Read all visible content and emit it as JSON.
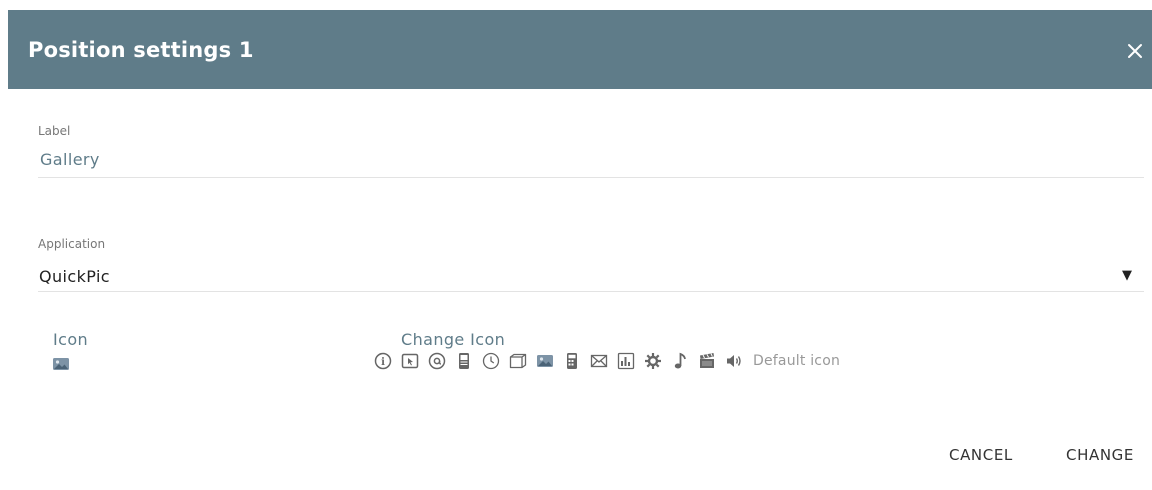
{
  "dialog": {
    "title": "Position settings 1",
    "close_icon": "close-icon"
  },
  "label_field": {
    "label": "Label",
    "value": "Gallery"
  },
  "application_field": {
    "label": "Application",
    "value": "QuickPic",
    "dropdown_icon": "caret-down-icon"
  },
  "icon_section": {
    "title": "Icon",
    "current_icon": "gallery-icon"
  },
  "change_icon_section": {
    "title": "Change Icon",
    "icons": [
      "info-icon",
      "cursor-icon",
      "at-sign-icon",
      "phone-icon",
      "clock-icon",
      "folder-icon",
      "gallery-icon",
      "calculator-icon",
      "mail-icon",
      "chart-icon",
      "gear-icon",
      "music-note-icon",
      "clapperboard-icon",
      "speaker-icon"
    ],
    "default_label": "Default icon"
  },
  "buttons": {
    "cancel": "CANCEL",
    "change": "CHANGE"
  },
  "colors": {
    "header": "#5f7c89",
    "accent": "#5f7c89",
    "icon": "#666666"
  }
}
